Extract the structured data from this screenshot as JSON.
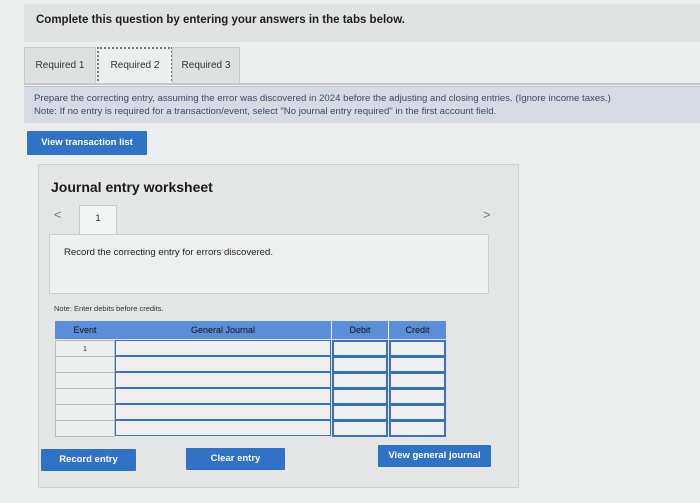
{
  "header": {
    "text": "Complete this question by entering your answers in the tabs below."
  },
  "tabs": [
    {
      "label": "Required 1"
    },
    {
      "label": "Required 2"
    },
    {
      "label": "Required 3"
    }
  ],
  "instructions": {
    "line1": "Prepare the correcting entry, assuming the error was discovered in 2024 before the adjusting and closing entries. (Ignore income taxes.)",
    "line2": "Note: If no entry is required for a transaction/event, select \"No journal entry required\" in the first account field."
  },
  "buttons": {
    "view_transaction_list": "View transaction list",
    "record_entry": "Record entry",
    "clear_entry": "Clear entry",
    "view_general_journal": "View general journal"
  },
  "worksheet": {
    "title": "Journal entry worksheet",
    "nav_prev": "<",
    "nav_next": ">",
    "page_number": "1",
    "description": "Record the correcting entry for errors discovered.",
    "note": "Note: Enter debits before credits.",
    "table": {
      "headers": [
        "Event",
        "General Journal",
        "Debit",
        "Credit"
      ],
      "rows": [
        {
          "event": "1",
          "account": "",
          "debit": "",
          "credit": ""
        },
        {
          "event": "",
          "account": "",
          "debit": "",
          "credit": ""
        },
        {
          "event": "",
          "account": "",
          "debit": "",
          "credit": ""
        },
        {
          "event": "",
          "account": "",
          "debit": "",
          "credit": ""
        },
        {
          "event": "",
          "account": "",
          "debit": "",
          "credit": ""
        },
        {
          "event": "",
          "account": "",
          "debit": "",
          "credit": ""
        }
      ]
    }
  },
  "colors": {
    "accent": "#2f72c6",
    "table_header": "#5b8ed9"
  }
}
